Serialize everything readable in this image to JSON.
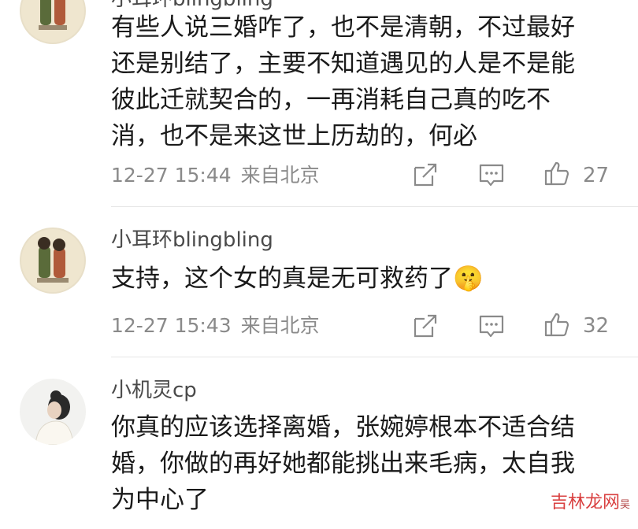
{
  "comments": [
    {
      "username": "小耳环blingbling",
      "text": "有些人说三婚咋了，也不是清朝，不过最好还是别结了，主要不知道遇见的人是不是能彼此迁就契合的，一再消耗自己真的吃不消，也不是来这世上历劫的，何必",
      "time": "12-27 15:44",
      "location": "来自北京",
      "likes": "27"
    },
    {
      "username": "小耳环blingbling",
      "text": "支持，这个女的真是无可救药了🤫",
      "time": "12-27 15:43",
      "location": "来自北京",
      "likes": "32"
    },
    {
      "username": "小机灵cp",
      "text": "你真的应该选择离婚，张婉婷根本不适合结婚，你做的再好她都能挑出来毛病，太自我为中心了",
      "time": "",
      "location": "",
      "likes": ""
    }
  ],
  "icons": {
    "repost": "share-square-icon",
    "comment": "comment-bubble-icon",
    "like": "thumbs-up-icon"
  },
  "watermark": {
    "text": "吉林龙网",
    "sub": "吴"
  },
  "colors": {
    "text": "#1a1a1a",
    "meta": "#8a8a8a",
    "username": "#4a4a4a",
    "divider": "#e6e6e6",
    "watermark": "#d94040"
  }
}
